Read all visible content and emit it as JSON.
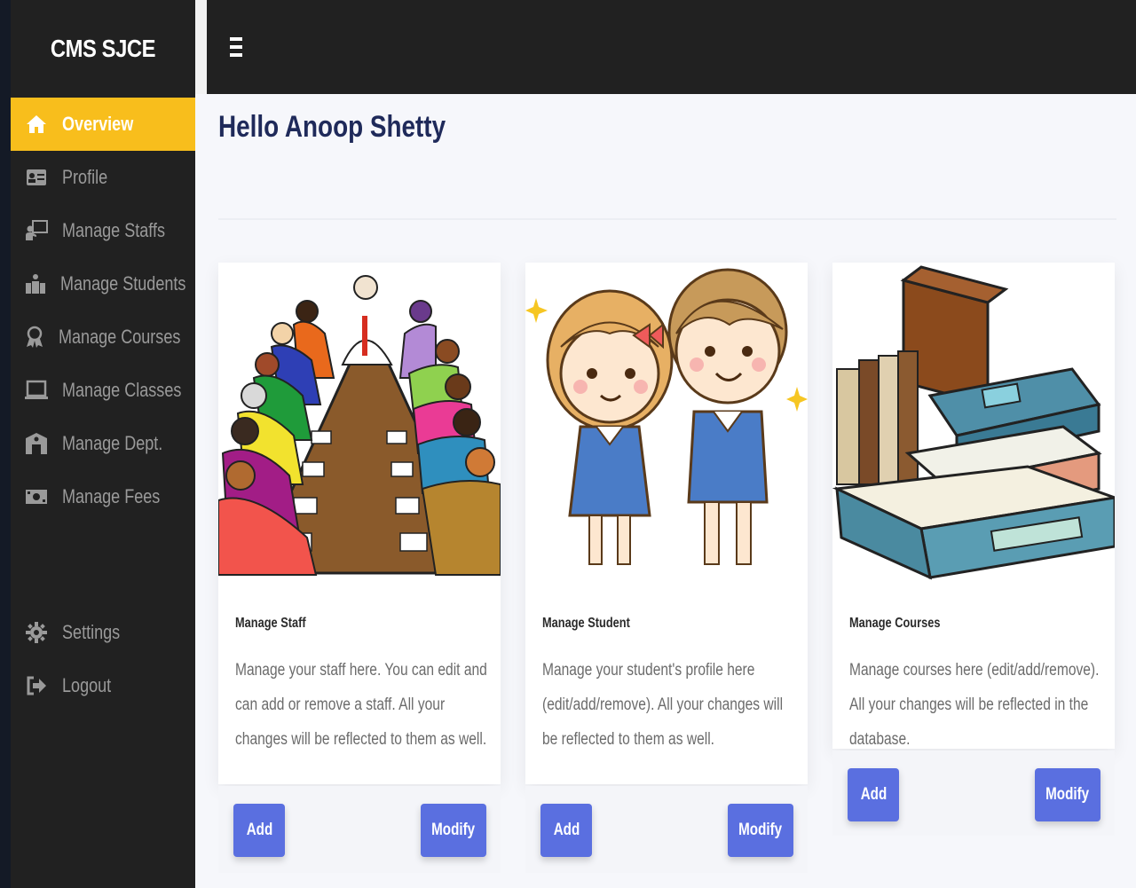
{
  "app": {
    "title": "CMS SJCE"
  },
  "sidebar": {
    "items": [
      {
        "label": "Overview",
        "icon": "home-icon",
        "active": true
      },
      {
        "label": "Profile",
        "icon": "id-card-icon"
      },
      {
        "label": "Manage Staffs",
        "icon": "chalkboard-teacher-icon"
      },
      {
        "label": "Manage Students",
        "icon": "users-icon"
      },
      {
        "label": "Manage Courses",
        "icon": "award-icon"
      },
      {
        "label": "Manage Classes",
        "icon": "laptop-icon"
      },
      {
        "label": "Manage Dept.",
        "icon": "building-icon"
      },
      {
        "label": "Manage Fees",
        "icon": "money-bill-icon"
      }
    ],
    "bottom_items": [
      {
        "label": "Settings",
        "icon": "gear-icon"
      },
      {
        "label": "Logout",
        "icon": "sign-out-icon"
      }
    ]
  },
  "header": {
    "greeting": "Hello Anoop Shetty"
  },
  "cards": [
    {
      "title": "Manage Staff",
      "description": "Manage your staff here. You can edit and can add or remove a staff. All your changes will be reflected to them as well.",
      "image": "staff-meeting-illustration",
      "add_label": "Add",
      "modify_label": "Modify"
    },
    {
      "title": "Manage Student",
      "description": "Manage your student's profile here (edit/add/remove). All your changes will be reflected to them as well.",
      "image": "students-illustration",
      "add_label": "Add",
      "modify_label": "Modify"
    },
    {
      "title": "Manage Courses",
      "description": "Manage courses here (edit/add/remove). All your changes will be reflected in the database.",
      "image": "books-illustration",
      "add_label": "Add",
      "modify_label": "Modify"
    }
  ],
  "colors": {
    "accent": "#f8be1c",
    "sidebar_bg": "#212121",
    "button": "#5a6fe0",
    "heading": "#1f2a5a"
  }
}
